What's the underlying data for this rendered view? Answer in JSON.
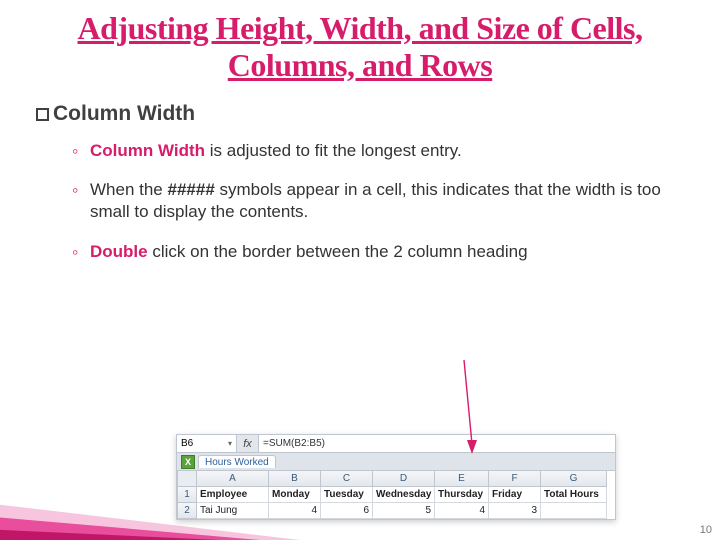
{
  "title": "Adjusting Height, Width, and Size of Cells, Columns, and Rows",
  "subhead": {
    "label": "Column Width"
  },
  "points": [
    {
      "strong": "Column Width",
      "rest": " is adjusted to fit the longest entry."
    },
    {
      "pre": "When the ",
      "strong": "#####",
      "rest": " symbols appear in a cell, this indicates that the width is too small to display the contents."
    },
    {
      "strong": "Double",
      "rest": " click on the border between the 2 column heading"
    }
  ],
  "excel": {
    "namebox": "B6",
    "fx_label": "fx",
    "formula": "=SUM(B2:B5)",
    "tab": "Hours Worked",
    "cols": [
      "A",
      "B",
      "C",
      "D",
      "E",
      "F",
      "G"
    ],
    "rows": [
      "1",
      "2"
    ],
    "data": [
      [
        "Employee",
        "Monday",
        "Tuesday",
        "Wednesday",
        "Thursday",
        "Friday",
        "Total Hours"
      ],
      [
        "Tai Jung",
        "4",
        "6",
        "5",
        "4",
        "3",
        ""
      ]
    ]
  },
  "page_number": "10"
}
